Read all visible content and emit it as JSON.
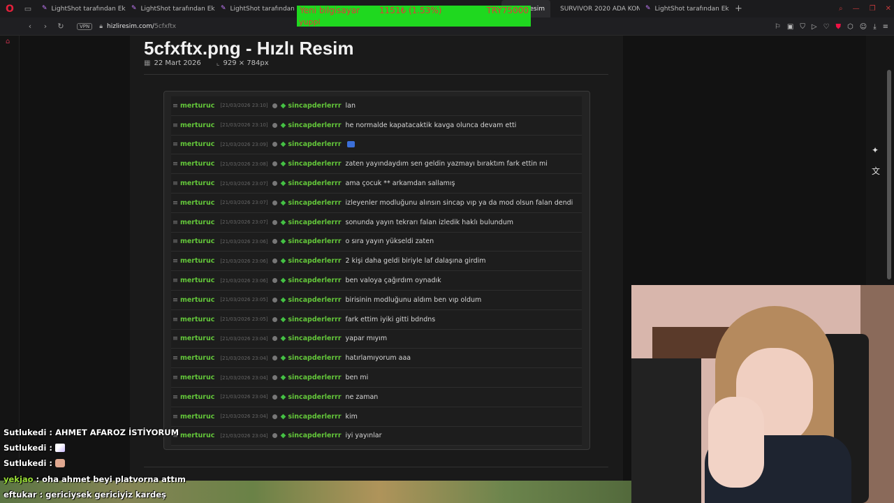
{
  "tabs": [
    {
      "label": "LightShot tarafından Ekran",
      "active": false
    },
    {
      "label": "LightShot tarafından Ekran",
      "active": false
    },
    {
      "label": "LightShot tarafından Ekran",
      "active": false
    },
    {
      "label": "- Hızlı Resim",
      "active": true
    },
    {
      "label": "SURVIVOR 2020 ADA KON",
      "active": false
    },
    {
      "label": "LightShot tarafından Ekran",
      "active": false
    }
  ],
  "address": {
    "vpn": "VPN",
    "domain": "hizliresim.com/",
    "path": "5cfxftx"
  },
  "donation": {
    "line1": "Yeni bilgisayar",
    "amount": "1151₺ (1.53%)",
    "goal": "TRY75000",
    "line2": "yuppi"
  },
  "page": {
    "title": "5cfxftx.png - Hızlı Resim",
    "date": "22 Mart 2026",
    "dimensions": "929 × 784px"
  },
  "chat_rows": [
    {
      "user1": "merturuc",
      "ts": "[21/03/2026 23:10]",
      "user2": "sincapderlerrr",
      "msg": "lan"
    },
    {
      "user1": "merturuc",
      "ts": "[21/03/2026 23:10]",
      "user2": "sincapderlerrr",
      "msg": "he normalde kapatacaktik kavga olunca devam etti"
    },
    {
      "user1": "merturuc",
      "ts": "[21/03/2026 23:09]",
      "user2": "sincapderlerrr",
      "msg": ""
    },
    {
      "user1": "merturuc",
      "ts": "[21/03/2026 23:08]",
      "user2": "sincapderlerrr",
      "msg": "zaten yayındaydım sen geldin yazmayı bıraktım fark ettin mi"
    },
    {
      "user1": "merturuc",
      "ts": "[21/03/2026 23:07]",
      "user2": "sincapderlerrr",
      "msg": "ama çocuk ** arkamdan sallamış"
    },
    {
      "user1": "merturuc",
      "ts": "[21/03/2026 23:07]",
      "user2": "sincapderlerrr",
      "msg": "izleyenler modluğunu alınsın sincap vıp ya da mod olsun falan dendi"
    },
    {
      "user1": "merturuc",
      "ts": "[21/03/2026 23:07]",
      "user2": "sincapderlerrr",
      "msg": "sonunda yayın tekrarı falan izledik haklı bulundum"
    },
    {
      "user1": "merturuc",
      "ts": "[21/03/2026 23:06]",
      "user2": "sincapderlerrr",
      "msg": "o sıra yayın yükseldi zaten"
    },
    {
      "user1": "merturuc",
      "ts": "[21/03/2026 23:06]",
      "user2": "sincapderlerrr",
      "msg": "2 kişi daha geldi biriyle laf dalaşına girdim"
    },
    {
      "user1": "merturuc",
      "ts": "[21/03/2026 23:06]",
      "user2": "sincapderlerrr",
      "msg": "ben valoya çağırdım oynadık"
    },
    {
      "user1": "merturuc",
      "ts": "[21/03/2026 23:05]",
      "user2": "sincapderlerrr",
      "msg": "birisinin modluğunu aldım ben vıp oldum"
    },
    {
      "user1": "merturuc",
      "ts": "[21/03/2026 23:05]",
      "user2": "sincapderlerrr",
      "msg": "fark ettim iyiki gitti bdndns"
    },
    {
      "user1": "merturuc",
      "ts": "[21/03/2026 23:04]",
      "user2": "sincapderlerrr",
      "msg": "yapar mıyım"
    },
    {
      "user1": "merturuc",
      "ts": "[21/03/2026 23:04]",
      "user2": "sincapderlerrr",
      "msg": "hatırlamıyorum aaa"
    },
    {
      "user1": "merturuc",
      "ts": "[21/03/2026 23:04]",
      "user2": "sincapderlerrr",
      "msg": "ben mi"
    },
    {
      "user1": "merturuc",
      "ts": "[21/03/2026 23:04]",
      "user2": "sincapderlerrr",
      "msg": "ne zaman"
    },
    {
      "user1": "merturuc",
      "ts": "[21/03/2026 23:04]",
      "user2": "sincapderlerrr",
      "msg": "kim"
    },
    {
      "user1": "merturuc",
      "ts": "[21/03/2026 23:04]",
      "user2": "sincapderlerrr",
      "msg": "iyi yayınlar"
    }
  ],
  "stream_chat": [
    {
      "name": "Sutlukedi",
      "msg": "AHMET AFAROZ İSTİYORUM",
      "highlight": false
    },
    {
      "name": "Sutlukedi",
      "msg": "",
      "highlight": false
    },
    {
      "name": "Sutlukedi",
      "msg": "",
      "highlight": false
    },
    {
      "name": "yekjao",
      "msg": "oha ahmet beyi platvorna attım",
      "highlight": true
    },
    {
      "name": "eftukar",
      "msg": "gericiysek gericiyiz kardeş",
      "highlight": false
    }
  ]
}
